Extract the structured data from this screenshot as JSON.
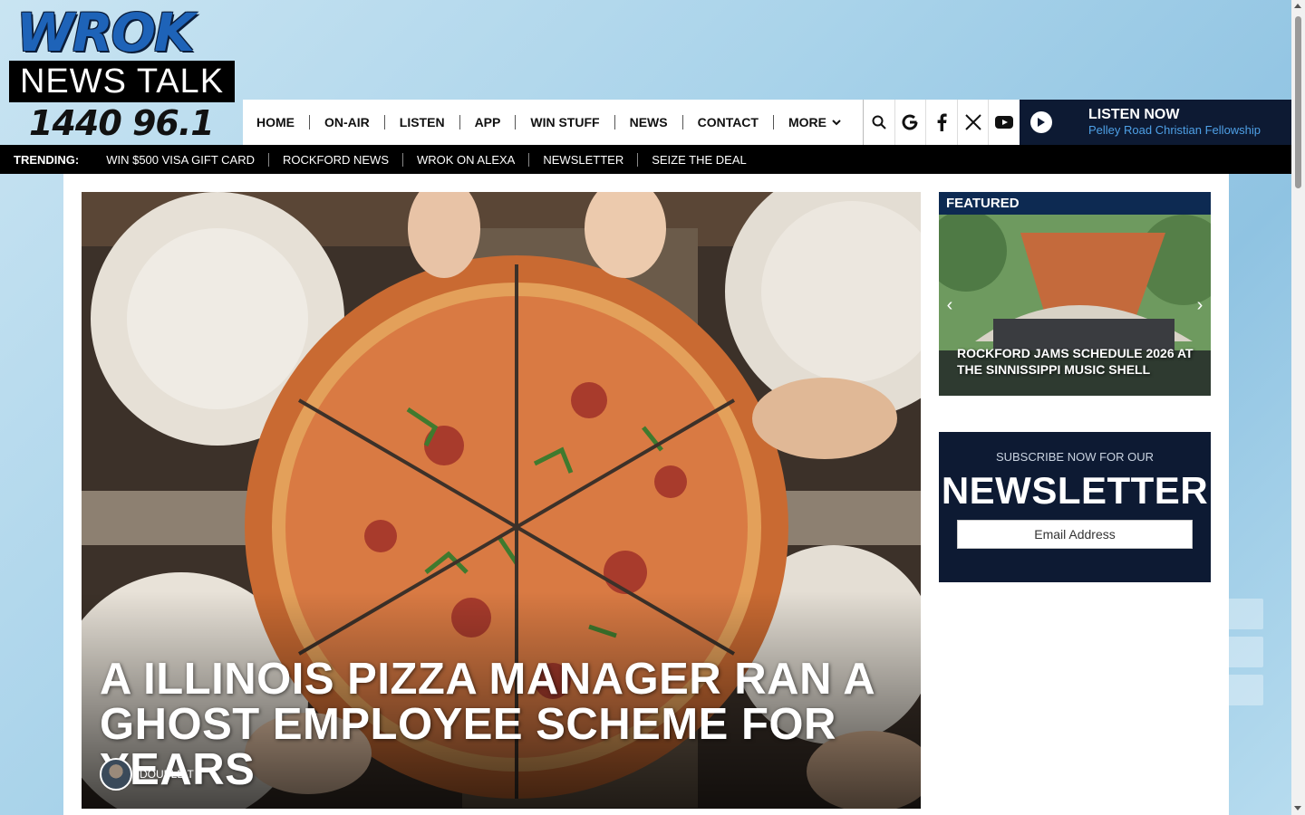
{
  "logo": {
    "brand": "WROK",
    "line2": "NEWS TALK",
    "freq": "1440  96.1"
  },
  "nav": {
    "items": [
      "HOME",
      "ON-AIR",
      "LISTEN",
      "APP",
      "WIN STUFF",
      "NEWS",
      "CONTACT"
    ],
    "more_label": "MORE",
    "icons": [
      "search-icon",
      "google-icon",
      "facebook-icon",
      "x-icon",
      "youtube-icon"
    ]
  },
  "listen": {
    "title": "LISTEN NOW",
    "subtitle": "Pelley Road Christian Fellowship"
  },
  "trending": {
    "label": "TRENDING:",
    "items": [
      "WIN $500 VISA GIFT CARD",
      "ROCKFORD NEWS",
      "WROK ON ALEXA",
      "NEWSLETTER",
      "SEIZE THE DEAL"
    ]
  },
  "hero": {
    "title": "A ILLINOIS PIZZA MANAGER RAN A GHOST EMPLOYEE SCHEME FOR YEARS",
    "author": "DOUBLE T"
  },
  "featured": {
    "heading": "FEATURED",
    "caption": "ROCKFORD JAMS SCHEDULE 2026 AT THE SINNISSIPPI MUSIC SHELL"
  },
  "newsletter": {
    "subtitle": "SUBSCRIBE NOW FOR OUR",
    "title": "NEWSLETTER",
    "placeholder": "Email Address"
  },
  "colors": {
    "navy": "#0d1a33",
    "accent_blue": "#1e63b8",
    "featured_head": "#0d2a52",
    "link_blue": "#4ea0e6"
  }
}
